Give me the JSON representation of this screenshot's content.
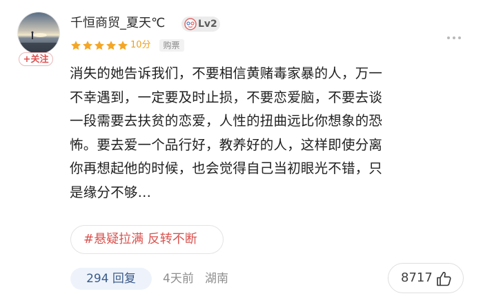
{
  "user": {
    "name": "千恒商贸_夏天℃",
    "level": "Lv2",
    "follow_label": "+关注"
  },
  "rating": {
    "stars": 5,
    "score_text": "10分",
    "purchase_label": "购票",
    "star_color": "#f5a623"
  },
  "review": {
    "lines": [
      "消失的她告诉我们，不要相信黄赌毒家暴的人，万一",
      "不幸遇到，一定要及时止损，不要恋爱脑，不要去谈",
      "一段需要去扶贫的恋爱，人性的扭曲远比你想象的恐",
      "怖。要去爱一个品行好，教养好的人，这样即使分离",
      "你再想起他的时候，也会觉得自己当初眼光不错，只",
      "是缘分不够…"
    ]
  },
  "topic": {
    "label": "#悬疑拉满 反转不断",
    "color": "#d9534f"
  },
  "footer": {
    "reply_label": "294 回复",
    "time": "4天前",
    "location": "湖南",
    "like_count": "8717"
  },
  "icons": {
    "more": "more-dots-icon",
    "like": "thumbs-up-icon",
    "level": "level-face-icon"
  }
}
